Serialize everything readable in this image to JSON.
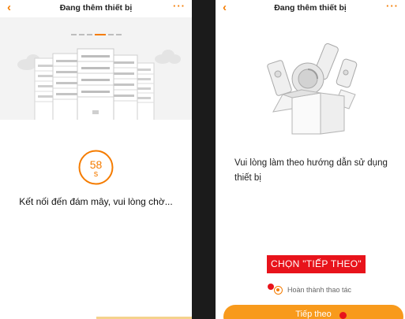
{
  "left_screen": {
    "nav": {
      "back_icon": "chevron-left-icon",
      "title": "Đang thêm thiết bị",
      "more_icon": "more-dots-icon",
      "more_glyph": "···"
    },
    "illustration": "server-racks-icon",
    "timer": {
      "value": "58",
      "unit": "s",
      "progress": 0.15
    },
    "status_text": "Kết nối đến đám mây, vui lòng chờ..."
  },
  "right_screen": {
    "nav": {
      "back_icon": "chevron-left-icon",
      "title": "Đang thêm thiết bị",
      "more_icon": "more-dots-icon",
      "more_glyph": "···"
    },
    "illustration": "open-box-devices-icon",
    "instruction": "Vui lòng làm theo hướng dẫn sử dụng thiết bị",
    "highlight_label": "CHỌN \"TIẾP THEO\"",
    "confirm_label": "Hoàn thành thao tác",
    "next_button": "Tiếp theo"
  },
  "colors": {
    "accent": "#f57c00",
    "button": "#f89a1c",
    "highlight": "#e8131b"
  }
}
